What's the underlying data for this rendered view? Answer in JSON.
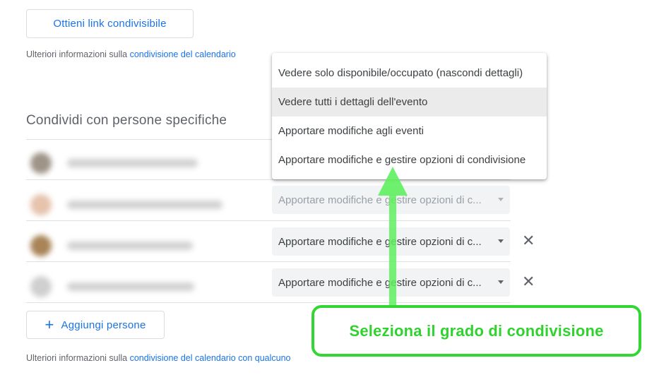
{
  "share_link_button": "Ottieni link condivisibile",
  "info_top": {
    "prefix": "Ulteriori informazioni sulla ",
    "link": "condivisione del calendario"
  },
  "section_title": "Condividi con persone specifiche",
  "rows": [
    {
      "permission": "Apportare modifiche e gestire opzioni di c..."
    },
    {
      "permission": "Apportare modifiche e gestire opzioni di c...",
      "remove": "✕"
    },
    {
      "permission": "Apportare modifiche e gestire opzioni di c...",
      "remove": "✕"
    }
  ],
  "dropdown": {
    "items": [
      "Vedere solo disponibile/occupato (nascondi dettagli)",
      "Vedere tutti i dettagli dell'evento",
      "Apportare modifiche agli eventi",
      "Apportare modifiche e gestire opzioni di condivisione"
    ],
    "highlighted_index": 1
  },
  "add_people": {
    "icon": "plus-icon",
    "symbol": "+",
    "label": "Aggiungi persone"
  },
  "info_bottom": {
    "prefix": "Ulteriori informazioni sulla ",
    "link": "condivisione del calendario con qualcuno"
  },
  "callout": "Seleziona il grado di condivisione",
  "colors": {
    "accent": "#1a73e8",
    "annotation_green": "#33d633"
  }
}
